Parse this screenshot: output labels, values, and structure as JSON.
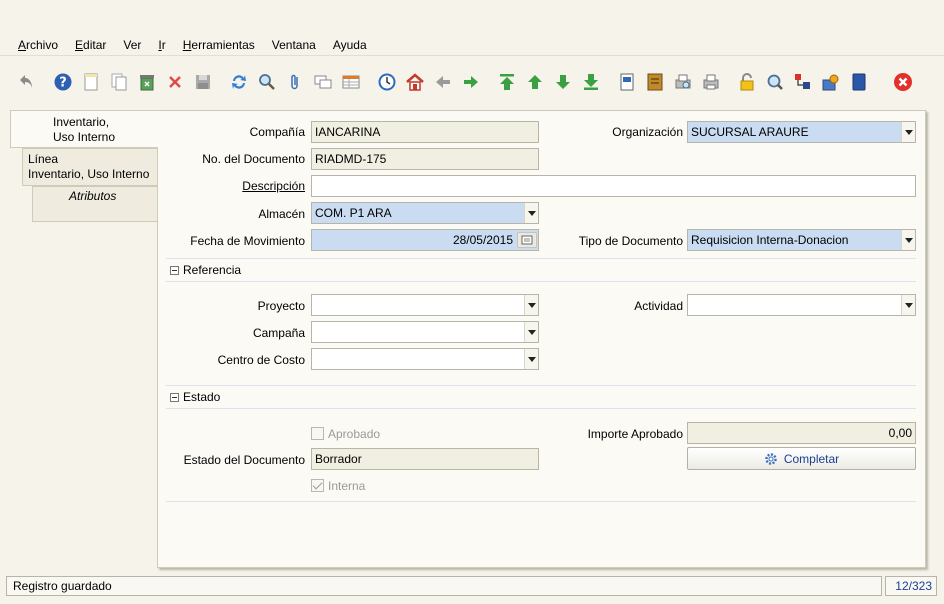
{
  "menu": [
    {
      "label": "Archivo",
      "ul": "A",
      "rest": "rchivo"
    },
    {
      "label": "Editar",
      "ul": "E",
      "rest": "ditar"
    },
    {
      "label": "Ver",
      "ul": "",
      "rest": "Ver"
    },
    {
      "label": "Ir",
      "ul": "I",
      "rest": "r"
    },
    {
      "label": "Herramientas",
      "ul": "H",
      "rest": "erramientas"
    },
    {
      "label": "Ventana",
      "ul": "",
      "rest": "Ventana"
    },
    {
      "label": "Ayuda",
      "ul": "",
      "rest": "Ayuda"
    }
  ],
  "tabs": {
    "tab1": {
      "line1": "Inventario,",
      "line2": "Uso Interno"
    },
    "tab2": {
      "line1": "Línea",
      "line2": "Inventario, Uso Interno"
    },
    "tab3": {
      "line1": "Atributos"
    }
  },
  "form": {
    "compania": {
      "label": "Compañía",
      "value": "IANCARINA"
    },
    "organizacion": {
      "label": "Organización",
      "value": "SUCURSAL ARAURE"
    },
    "documento": {
      "label": "No. del Documento",
      "value": "RIADMD-175"
    },
    "descripcion": {
      "label": "Descripción",
      "value": ""
    },
    "almacen": {
      "label": "Almacén",
      "value": "COM. P1 ARA"
    },
    "fecha": {
      "label": "Fecha de Movimiento",
      "value": "28/05/2015"
    },
    "tipo_documento": {
      "label": "Tipo de Documento",
      "value": "Requisicion Interna-Donacion"
    }
  },
  "referencia": {
    "title": "Referencia",
    "proyecto": {
      "label": "Proyecto",
      "value": ""
    },
    "actividad": {
      "label": "Actividad",
      "value": ""
    },
    "campana": {
      "label": "Campaña",
      "value": ""
    },
    "centro_costo": {
      "label": "Centro de Costo",
      "value": ""
    }
  },
  "estado": {
    "title": "Estado",
    "aprobado": {
      "label": "Aprobado",
      "checked": false
    },
    "importe": {
      "label": "Importe Aprobado",
      "value": "0,00"
    },
    "estado_doc": {
      "label": "Estado del Documento",
      "value": "Borrador"
    },
    "completar": {
      "label": "Completar"
    },
    "interna": {
      "label": "Interna",
      "checked": true
    }
  },
  "status": {
    "message": "Registro guardado",
    "record": "12/323"
  },
  "colors": {
    "accent_blue": "#c9dcf2",
    "link_blue": "#1a3f94"
  }
}
